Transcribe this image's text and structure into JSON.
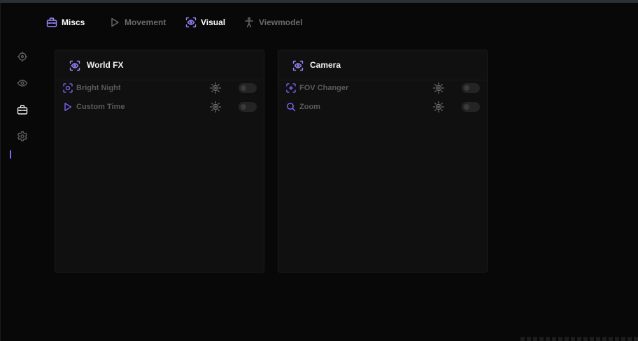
{
  "colors": {
    "accent": "#7b6cff",
    "background": "#080808",
    "panel": "#101010",
    "muted_text": "#6a6a6a",
    "label_text": "#5b5b5b"
  },
  "topnav": {
    "tabs": [
      {
        "label": "Miscs",
        "icon": "toolbox-icon",
        "active": true
      },
      {
        "label": "Movement",
        "icon": "play-icon",
        "active": false
      },
      {
        "label": "Visual",
        "icon": "eye-scan-icon",
        "active": true
      },
      {
        "label": "Viewmodel",
        "icon": "person-icon",
        "active": false
      }
    ]
  },
  "sidebar": {
    "items": [
      {
        "icon": "crosshair-icon"
      },
      {
        "icon": "eye-icon"
      },
      {
        "icon": "toolbox-icon",
        "active": true
      },
      {
        "icon": "gear-icon"
      }
    ]
  },
  "panels": [
    {
      "title": "World FX",
      "icon": "eye-scan-icon",
      "rows": [
        {
          "label": "Bright Night",
          "icon": "scan-icon",
          "enabled": false
        },
        {
          "label": "Custom Time",
          "icon": "play-icon",
          "enabled": false
        }
      ]
    },
    {
      "title": "Camera",
      "icon": "eye-scan-icon",
      "rows": [
        {
          "label": "FOV Changer",
          "icon": "scan-plus-icon",
          "enabled": false
        },
        {
          "label": "Zoom",
          "icon": "search-icon",
          "enabled": false
        }
      ]
    }
  ]
}
